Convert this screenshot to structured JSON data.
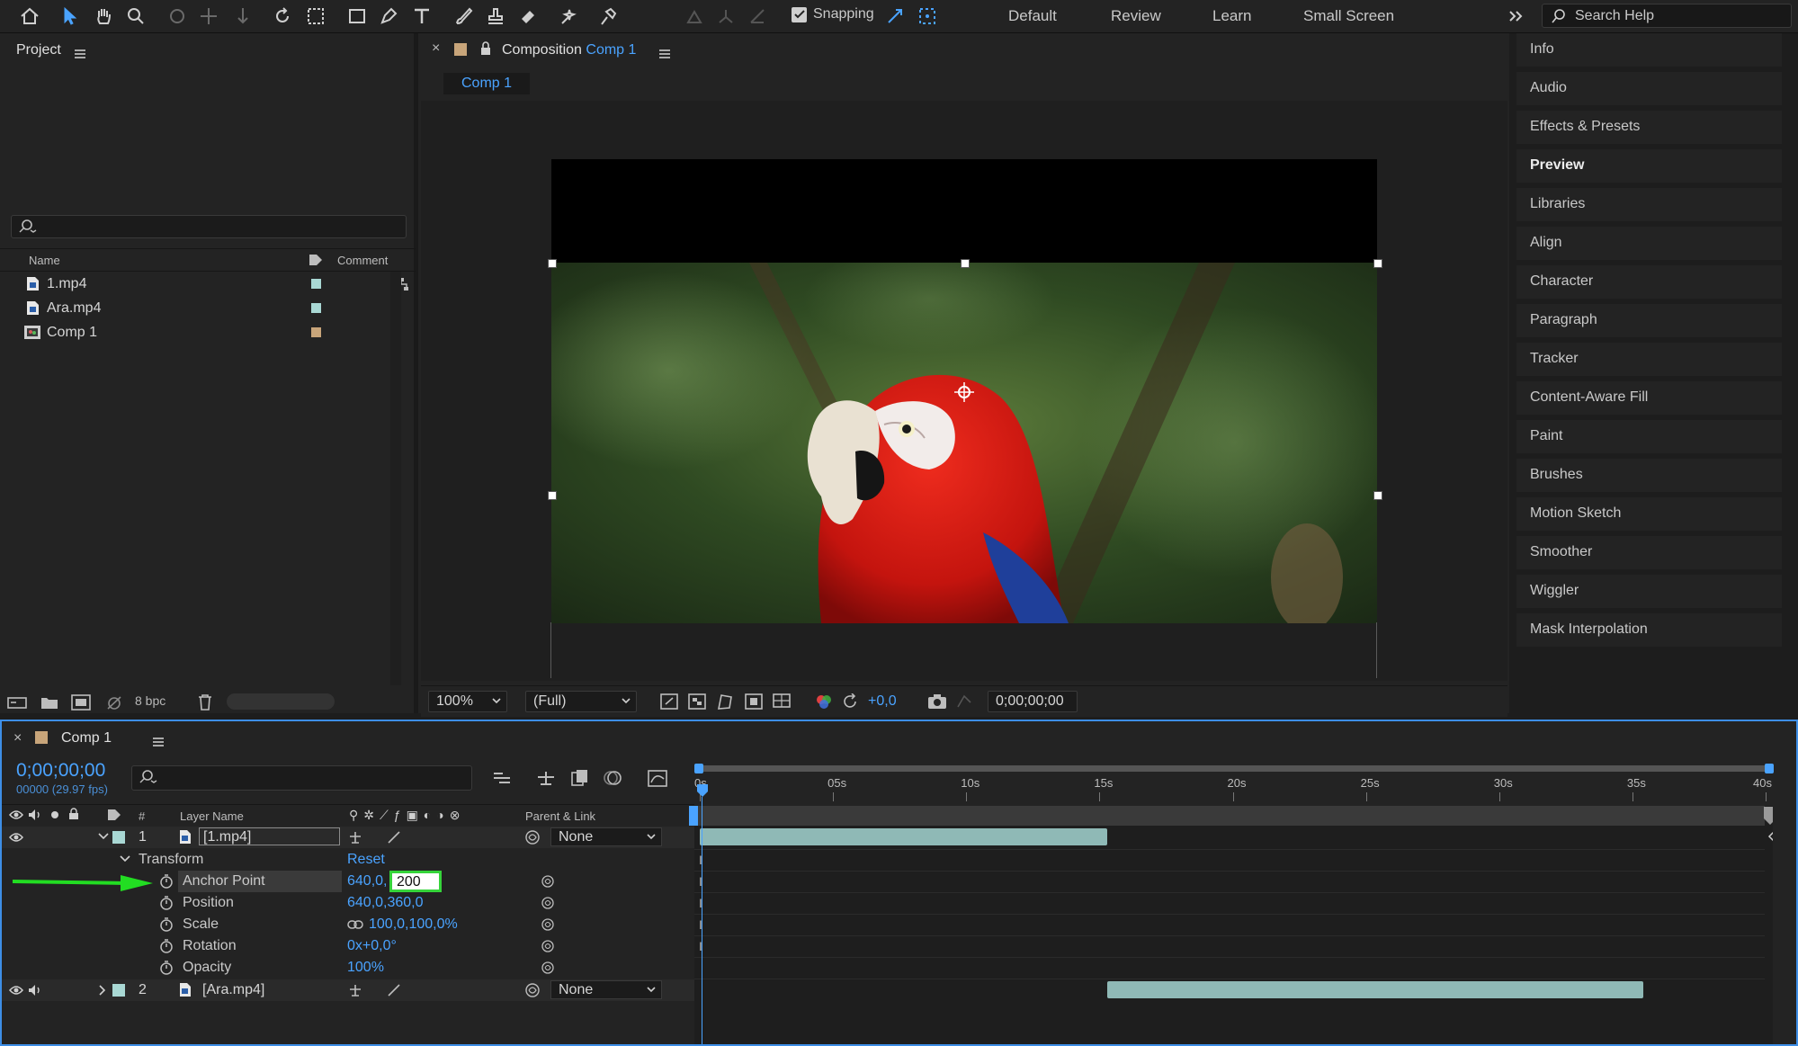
{
  "toolbar": {
    "snapping_label": "Snapping",
    "workspaces": [
      "Default",
      "Review",
      "Learn",
      "Small Screen"
    ],
    "search_placeholder": "Search Help",
    "overflow_icon": "double-chevron-right-icon"
  },
  "project": {
    "title": "Project",
    "columns": {
      "name": "Name",
      "comment": "Comment"
    },
    "items": [
      {
        "name": "1.mp4",
        "type": "footage",
        "label_color": "#a9d8d4"
      },
      {
        "name": "Ara.mp4",
        "type": "footage",
        "label_color": "#a9d8d4"
      },
      {
        "name": "Comp 1",
        "type": "composition",
        "label_color": "#c8a57a"
      }
    ],
    "bpc": "8 bpc"
  },
  "composition": {
    "panel_label": "Composition",
    "comp_name": "Comp 1",
    "tab": "Comp 1",
    "zoom": "100%",
    "resolution": "(Full)",
    "exposure": "+0,0",
    "timecode": "0;00;00;00"
  },
  "right_panel": {
    "items": [
      "Info",
      "Audio",
      "Effects & Presets",
      "Preview",
      "Libraries",
      "Align",
      "Character",
      "Paragraph",
      "Tracker",
      "Content-Aware Fill",
      "Paint",
      "Brushes",
      "Motion Sketch",
      "Smoother",
      "Wiggler",
      "Mask Interpolation"
    ],
    "active": "Preview"
  },
  "timeline": {
    "tab": "Comp 1",
    "timecode": "0;00;00;00",
    "frames": "00000 (29.97 fps)",
    "columns": {
      "num": "#",
      "layer_name": "Layer Name",
      "parent_link": "Parent & Link"
    },
    "ruler": [
      "0s",
      "05s",
      "10s",
      "15s",
      "20s",
      "25s",
      "30s",
      "35s",
      "40s"
    ],
    "layers": [
      {
        "num": "1",
        "name": "[1.mp4]",
        "parent": "None",
        "label_color": "#a9d8d4"
      },
      {
        "num": "2",
        "name": "[Ara.mp4]",
        "parent": "None",
        "label_color": "#a9d8d4"
      }
    ],
    "transform": {
      "label": "Transform",
      "reset": "Reset",
      "properties": [
        {
          "name": "Anchor Point",
          "value": "640,0,",
          "edit_value": "200"
        },
        {
          "name": "Position",
          "value": "640,0,360,0"
        },
        {
          "name": "Scale",
          "value": "100,0,100,0%"
        },
        {
          "name": "Rotation",
          "value": "0x+0,0°"
        },
        {
          "name": "Opacity",
          "value": "100%"
        }
      ]
    },
    "layer1_bar": {
      "start_s": 0,
      "end_s": 15.3
    },
    "layer2_bar": {
      "start_s": 15.3,
      "end_s": 35.4
    }
  },
  "colors": {
    "accent": "#4aa3ff",
    "highlight_box": "#35d43a",
    "annotation_arrow": "#22dd22"
  }
}
